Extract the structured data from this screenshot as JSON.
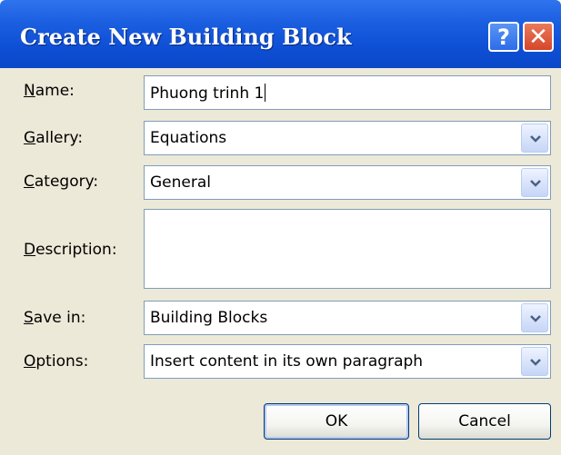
{
  "dialog": {
    "title": "Create New Building Block",
    "help_glyph": "?",
    "close_glyph": "✕"
  },
  "fields": {
    "name": {
      "label_first": "N",
      "label_rest": "ame:",
      "value": "Phuong trinh 1"
    },
    "gallery": {
      "label_first": "G",
      "label_rest": "allery:",
      "value": "Equations"
    },
    "category": {
      "label_first": "C",
      "label_rest": "ategory:",
      "value": "General"
    },
    "description": {
      "label_first": "D",
      "label_rest": "escription:",
      "value": ""
    },
    "save_in": {
      "label_first": "S",
      "label_rest": "ave in:",
      "value": "Building Blocks"
    },
    "options": {
      "label_first": "O",
      "label_rest": "ptions:",
      "value": "Insert content in its own paragraph"
    }
  },
  "buttons": {
    "ok": "OK",
    "cancel": "Cancel"
  },
  "icons": {
    "help": "help-icon",
    "close": "close-icon",
    "dropdown": "chevron-down-icon"
  },
  "colors": {
    "titlebar": "#0e4fd5",
    "client_bg": "#ece9d8",
    "close_button": "#d5462b",
    "field_border": "#7f9db9"
  }
}
